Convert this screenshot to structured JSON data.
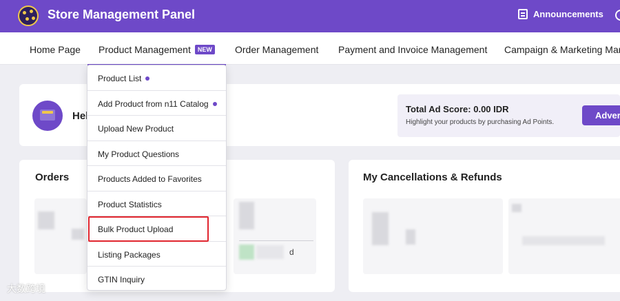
{
  "header": {
    "app_title": "Store Management Panel",
    "announcements_label": "Announcements"
  },
  "nav": {
    "items": [
      {
        "label": "Home Page"
      },
      {
        "label": "Product Management",
        "badge": "NEW"
      },
      {
        "label": "Order Management"
      },
      {
        "label": "Payment and Invoice Management"
      },
      {
        "label": "Campaign & Marketing Man"
      }
    ]
  },
  "product_menu": {
    "items": [
      {
        "label": "Product List"
      },
      {
        "label": "Add Product from n11 Catalog"
      },
      {
        "label": "Upload New Product"
      },
      {
        "label": "My Product Questions"
      },
      {
        "label": "Products Added to Favorites"
      },
      {
        "label": "Product Statistics"
      },
      {
        "label": "Bulk Product Upload"
      },
      {
        "label": "Listing Packages"
      },
      {
        "label": "GTIN Inquiry"
      }
    ]
  },
  "welcome": {
    "greeting_fragment": "Hel"
  },
  "ad_score": {
    "title": "Total Ad Score: 0.00 IDR",
    "subtitle": "Highlight your products by purchasing Ad Points.",
    "button_label": "Advert"
  },
  "orders": {
    "title": "Orders",
    "fragment": "d"
  },
  "refunds": {
    "title": "My Cancellations & Refunds"
  },
  "watermark": "大数跨境",
  "colors": {
    "brand": "#6e49c8",
    "highlight": "#e0252e"
  }
}
